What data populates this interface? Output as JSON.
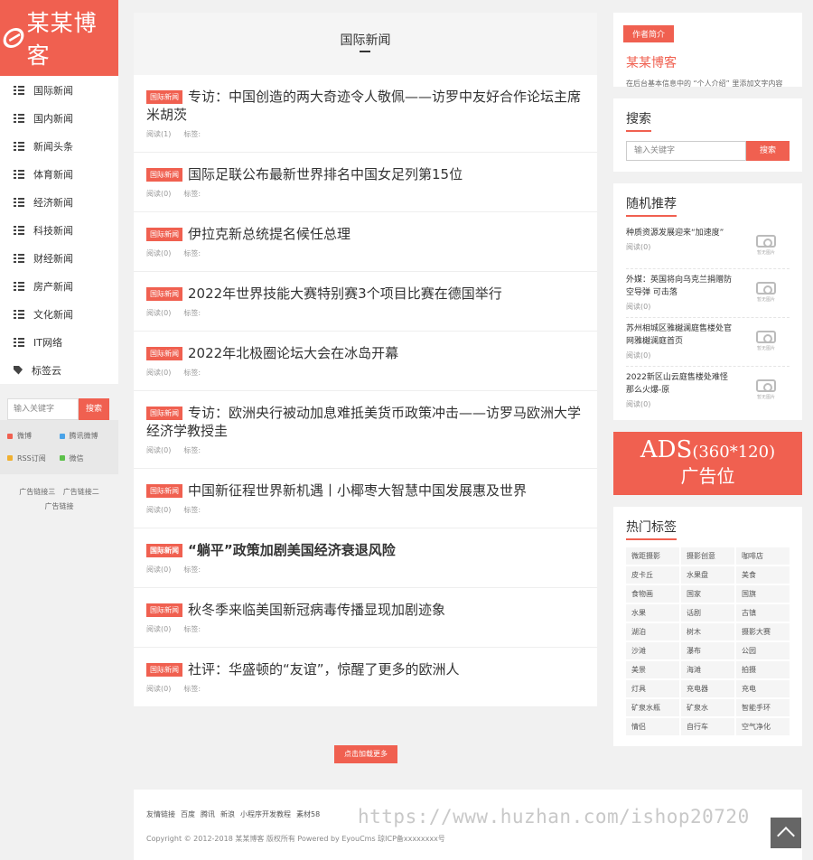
{
  "logo": {
    "name": "某某博客"
  },
  "sidebar": {
    "items": [
      {
        "label": "国际新闻",
        "icon": "list-icon"
      },
      {
        "label": "国内新闻",
        "icon": "list-icon"
      },
      {
        "label": "新闻头条",
        "icon": "list-icon"
      },
      {
        "label": "体育新闻",
        "icon": "list-icon"
      },
      {
        "label": "经济新闻",
        "icon": "list-icon"
      },
      {
        "label": "科技新闻",
        "icon": "list-icon"
      },
      {
        "label": "财经新闻",
        "icon": "list-icon"
      },
      {
        "label": "房产新闻",
        "icon": "list-icon"
      },
      {
        "label": "文化新闻",
        "icon": "list-icon"
      },
      {
        "label": "IT网络",
        "icon": "list-icon"
      },
      {
        "label": "标签云",
        "icon": "tag-icon"
      }
    ],
    "search_placeholder": "输入关键字",
    "search_button": "搜索",
    "share": [
      {
        "label": "微博",
        "color": "#f06050"
      },
      {
        "label": "腾讯微博",
        "color": "#4aa3e8"
      },
      {
        "label": "RSS订阅",
        "color": "#f0b030"
      },
      {
        "label": "微信",
        "color": "#5cc04a"
      }
    ],
    "adlinks": [
      "广告链接三",
      "广告链接二",
      "广告链接"
    ]
  },
  "main": {
    "heading": "国际新闻",
    "badge": "国际新闻",
    "views_label": "阅读",
    "tags_label": "标签:",
    "articles": [
      {
        "title": "专访：中国创造的两大奇迹令人敬佩——访罗中友好合作论坛主席米胡茨",
        "views": "阅读(1)",
        "bold": false
      },
      {
        "title": "国际足联公布最新世界排名中国女足列第15位",
        "views": "阅读(0)",
        "bold": false
      },
      {
        "title": "伊拉克新总统提名候任总理",
        "views": "阅读(0)",
        "bold": false
      },
      {
        "title": "2022年世界技能大赛特别赛3个项目比赛在德国举行",
        "views": "阅读(0)",
        "bold": false
      },
      {
        "title": "2022年北极圈论坛大会在冰岛开幕",
        "views": "阅读(0)",
        "bold": false
      },
      {
        "title": "专访：欧洲央行被动加息难抵美货币政策冲击——访罗马欧洲大学经济学教授圭",
        "views": "阅读(0)",
        "bold": false
      },
      {
        "title": "中国新征程世界新机遇丨小椰枣大智慧中国发展惠及世界",
        "views": "阅读(0)",
        "bold": false
      },
      {
        "title": "“躺平”政策加剧美国经济衰退风险",
        "views": "阅读(0)",
        "bold": true
      },
      {
        "title": "秋冬季来临美国新冠病毒传播显现加剧迹象",
        "views": "阅读(0)",
        "bold": false
      },
      {
        "title": "社评：华盛顿的“友谊”，惊醒了更多的欧洲人",
        "views": "阅读(0)",
        "bold": false
      }
    ],
    "load_more": "点击加载更多"
  },
  "right": {
    "author": {
      "tag": "作者简介",
      "name": "某某博客",
      "desc": "在后台基本信息中的 “个人介绍” 里添加文字内容"
    },
    "search": {
      "title": "搜索",
      "placeholder": "输入关键字",
      "button": "搜索"
    },
    "random": {
      "title": "随机推荐",
      "thumb_caption": "暂无图片",
      "items": [
        {
          "title": "种质资源发展迎来“加速度”",
          "views": "阅读(0)"
        },
        {
          "title": "外媒：英国将向乌克兰捐赠防空导弹 可击落",
          "views": "阅读(0)"
        },
        {
          "title": "苏州相城区雅樾澜庭售楼处官网雅樾澜庭首页",
          "views": "阅读(0)"
        },
        {
          "title": "2022新区山云庭售楼处难怪那么火爆-原",
          "views": "阅读(0)"
        }
      ]
    },
    "ads": {
      "line1": "ADS",
      "size": "(360*120)",
      "line2": "广告位"
    },
    "hot_tags": {
      "title": "热门标签",
      "tags": [
        "微距摄影",
        "摄影创意",
        "咖啡店",
        "皮卡丘",
        "水果盘",
        "美食",
        "食物画",
        "国家",
        "国旗",
        "水果",
        "话剧",
        "古镇",
        "湖泊",
        "树木",
        "摄影大赛",
        "沙滩",
        "瀑布",
        "公园",
        "美景",
        "海滩",
        "拍摄",
        "灯具",
        "充电器",
        "充电",
        "矿泉水瓶",
        "矿泉水",
        "智能手环",
        "情侣",
        "自行车",
        "空气净化"
      ]
    }
  },
  "footer": {
    "links": [
      "友情链接",
      "百度",
      "腾讯",
      "新浪",
      "小程序开发教程",
      "素材58"
    ],
    "copyright": "Copyright © 2012-2018 某某博客 版权所有 Powered by EyouCms 琼ICP备xxxxxxxx号",
    "watermark": "https://www.huzhan.com/ishop20720"
  }
}
